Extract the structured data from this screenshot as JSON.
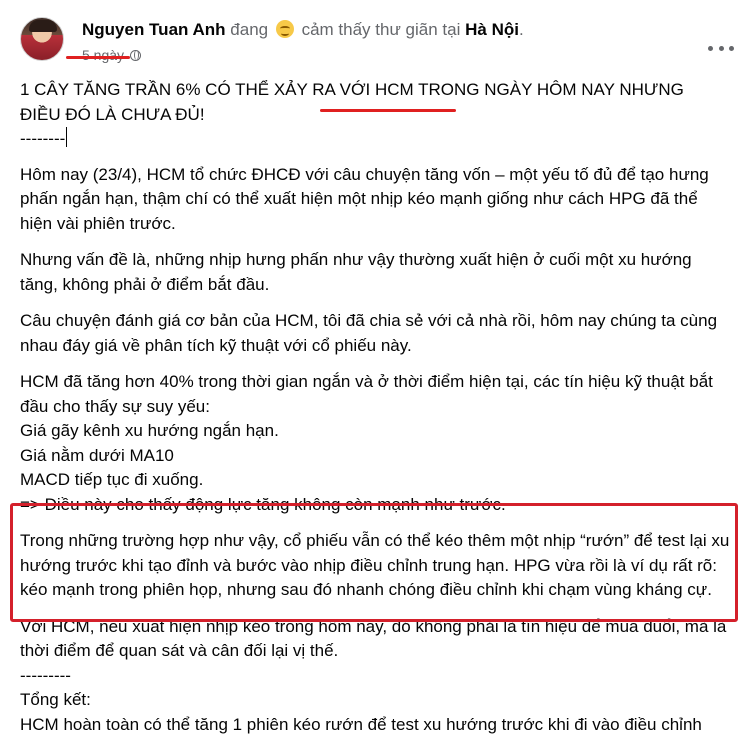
{
  "post": {
    "author": "Nguyen Tuan Anh",
    "activity_prefix": "đang",
    "activity_feeling": "cảm thấy thư giãn tại",
    "location": "Hà Nội",
    "location_suffix": ".",
    "time": "5 ngày",
    "privacy_icon": "globe-icon",
    "more_icon": "more-options-icon",
    "highlight_color": "#d4202b"
  },
  "body": {
    "title_line1": "1 CÂY TĂNG TRẦN 6% CÓ THỂ XẢY RA VỚI HCM TRONG NGÀY HÔM NAY NHƯNG",
    "title_line2": "ĐIỀU ĐÓ LÀ CHƯA ĐỦ!",
    "divider1": "--------",
    "p1": "Hôm nay (23/4), HCM tổ chức ĐHCĐ với câu chuyện tăng vốn – một yếu tố đủ để tạo hưng phấn ngắn hạn, thậm chí có thể xuất hiện một nhịp kéo mạnh giống như cách HPG đã thể hiện vài phiên trước.",
    "p2": "Nhưng vấn đề là, những nhịp hưng phấn như vậy thường xuất hiện ở cuối một xu hướng tăng, không phải ở điểm bắt đầu.",
    "p3": "Câu chuyện đánh giá cơ bản của HCM, tôi đã chia sẻ với cả nhà rồi, hôm nay chúng ta cùng nhau đáy giá về phân tích kỹ thuật với cổ phiếu này.",
    "p4_intro": "HCM đã tăng hơn 40% trong thời gian ngắn và ở thời điểm hiện tại, các tín hiệu kỹ thuật bắt đầu cho thấy sự suy yếu:",
    "p4_item1": "Giá gãy kênh xu hướng ngắn hạn.",
    "p4_item2": "Giá nằm dưới MA10",
    "p4_item3": "MACD tiếp tục đi xuống.",
    "p4_conclusion": "=> Điều này cho thấy động lực tăng không còn mạnh như trước.",
    "p5": "Trong những trường hợp như vậy, cổ phiếu vẫn có thể kéo thêm một nhịp “rướn” để test lại xu hướng trước khi tạo đỉnh và bước vào nhịp điều chỉnh trung hạn. HPG vừa rồi là ví dụ rất rõ: kéo mạnh trong phiên họp, nhưng sau đó nhanh chóng điều chỉnh khi chạm vùng kháng cự.",
    "p6": "Với HCM, nếu xuất hiện nhịp kéo trong hôm nay, đó không phải là tín hiệu để mua đuổi, mà là thời điểm để quan sát và cân đối lại vị thế.",
    "divider2": "---------",
    "summary_label": "Tổng kết:",
    "summary_partial": "HCM hoàn toàn có thể tăng 1 phiên kéo rướn để test xu hướng trước khi đi vào điều chỉnh"
  }
}
